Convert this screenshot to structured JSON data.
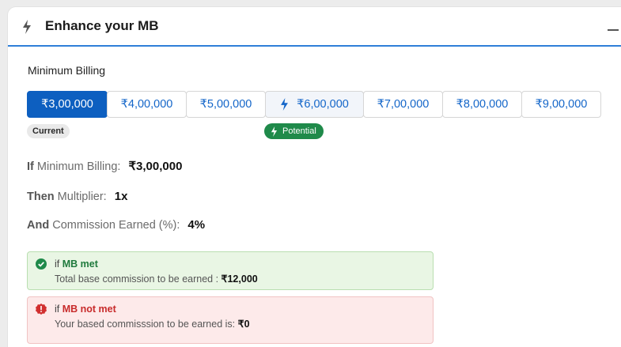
{
  "header": {
    "title": "Enhance your MB",
    "icon": "bolt-icon"
  },
  "section": {
    "label": "Minimum Billing"
  },
  "options": [
    {
      "label": "₹3,00,000",
      "state": "selected"
    },
    {
      "label": "₹4,00,000",
      "state": "default"
    },
    {
      "label": "₹5,00,000",
      "state": "default"
    },
    {
      "label": "₹6,00,000",
      "state": "potential",
      "icon": "bolt-icon"
    },
    {
      "label": "₹7,00,000",
      "state": "default"
    },
    {
      "label": "₹8,00,000",
      "state": "default"
    },
    {
      "label": "₹9,00,000",
      "state": "default"
    }
  ],
  "badges": {
    "current": "Current",
    "potential": "Potential"
  },
  "summary": {
    "if_kw": "If",
    "if_label": "Minimum Billing:",
    "if_value": "₹3,00,000",
    "then_kw": "Then",
    "then_label": "Multiplier:",
    "then_value": "1x",
    "and_kw": "And",
    "and_label": "Commission Earned (%):",
    "and_value": "4%"
  },
  "alerts": {
    "met": {
      "prefix": "if",
      "status": "MB met",
      "text": "Total base commission to be earned : ",
      "amount": "₹12,000",
      "icon": "check-badge-icon"
    },
    "not_met": {
      "prefix": "if",
      "status": "MB not met",
      "text": "Your based commisssion to be earned is: ",
      "amount": "₹0",
      "icon": "error-badge-icon"
    }
  },
  "colors": {
    "accent": "#0d5fc0",
    "link": "#1466c9",
    "success": "#1f8a4a",
    "error": "#c82b2b"
  }
}
